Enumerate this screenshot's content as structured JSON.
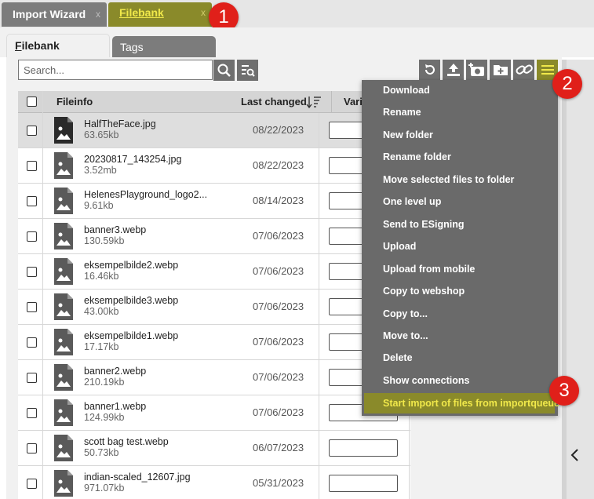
{
  "top_tabs": [
    {
      "label": "Import Wizard",
      "close": "x"
    },
    {
      "label": "Filebank",
      "close": "x"
    }
  ],
  "badges": [
    "1",
    "2",
    "3"
  ],
  "sub_tabs": [
    {
      "first": "F",
      "rest": "ilebank"
    },
    {
      "label": "Tags"
    }
  ],
  "search": {
    "placeholder": "Search..."
  },
  "toolbar": {
    "buttons": [
      "refresh-icon",
      "upload-icon",
      "add-photo-icon",
      "new-folder-icon",
      "link-icon",
      "hamburger-menu-icon"
    ]
  },
  "table": {
    "headers": {
      "fileinfo": "Fileinfo",
      "last_changed": "Last changed",
      "variant": "Vari"
    },
    "rows": [
      {
        "name": "HalfTheFace.jpg",
        "size": "63.65kb",
        "date": "08/22/2023",
        "selected": true
      },
      {
        "name": "20230817_143254.jpg",
        "size": "3.52mb",
        "date": "08/22/2023"
      },
      {
        "name": "HelenesPlayground_logo2...",
        "size": "9.61kb",
        "date": "08/14/2023"
      },
      {
        "name": "banner3.webp",
        "size": "130.59kb",
        "date": "07/06/2023"
      },
      {
        "name": "eksempelbilde2.webp",
        "size": "16.46kb",
        "date": "07/06/2023"
      },
      {
        "name": "eksempelbilde3.webp",
        "size": "43.00kb",
        "date": "07/06/2023"
      },
      {
        "name": "eksempelbilde1.webp",
        "size": "17.17kb",
        "date": "07/06/2023"
      },
      {
        "name": "banner2.webp",
        "size": "210.19kb",
        "date": "07/06/2023"
      },
      {
        "name": "banner1.webp",
        "size": "124.99kb",
        "date": "07/06/2023"
      },
      {
        "name": "scott bag test.webp",
        "size": "50.73kb",
        "date": "06/07/2023"
      },
      {
        "name": "indian-scaled_12607.jpg",
        "size": "971.07kb",
        "date": "05/31/2023"
      }
    ]
  },
  "menu": {
    "items": [
      "Download",
      "Rename",
      "New folder",
      "Rename folder",
      "Move selected files to folder",
      "One level up",
      "Send to ESigning",
      "Upload",
      "Upload from mobile",
      "Copy to webshop",
      "Copy to...",
      "Move to...",
      "Delete",
      "Show connections",
      "Start import of files from importqueue"
    ],
    "active_index": 14
  },
  "colors": {
    "accent": "#8a8a2a",
    "accent_text": "#f0e84a",
    "badge": "#e0201a",
    "menu_bg": "#6a6a6a"
  }
}
